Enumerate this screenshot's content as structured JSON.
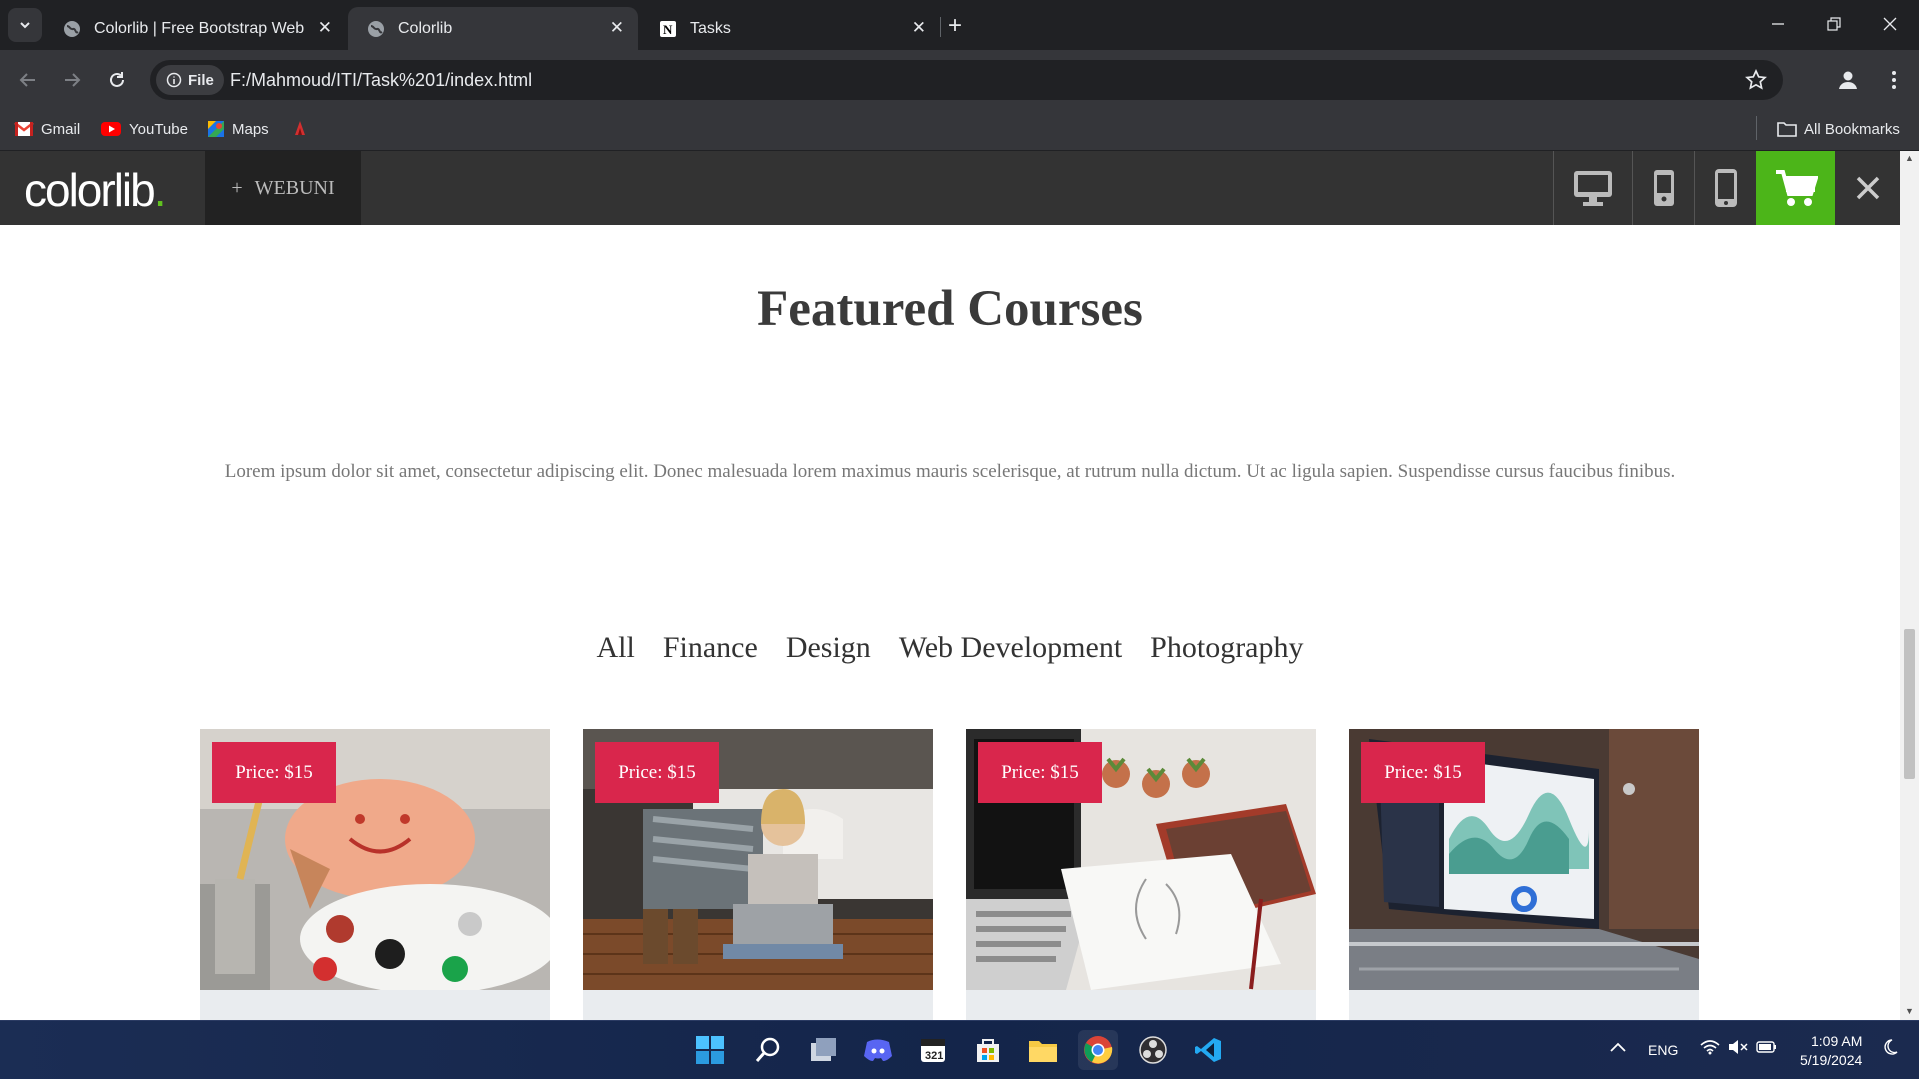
{
  "browser": {
    "tabs": [
      {
        "title": "Colorlib | Free Bootstrap Websit",
        "icon": "globe-icon",
        "active": false
      },
      {
        "title": "Colorlib",
        "icon": "globe-icon",
        "active": true
      },
      {
        "title": "Tasks",
        "icon": "notion-icon",
        "active": false
      }
    ],
    "address": {
      "chip": "File",
      "url": "F:/Mahmoud/ITI/Task%201/index.html"
    },
    "bookmarks": [
      {
        "label": "Gmail",
        "icon": "gmail-icon"
      },
      {
        "label": "YouTube",
        "icon": "youtube-icon"
      },
      {
        "label": "Maps",
        "icon": "maps-icon"
      }
    ],
    "all_bookmarks": "All Bookmarks"
  },
  "site": {
    "logo": "colorlib",
    "logo_dot": ".",
    "theme_label": "WEBUNI",
    "theme_plus": "+",
    "heading": "Featured Courses",
    "intro": "Lorem ipsum dolor sit amet, consectetur adipiscing elit. Donec malesuada lorem maximus mauris scelerisque, at rutrum nulla dictum. Ut ac ligula sapien. Suspendisse cursus faucibus finibus.",
    "filters": [
      "All",
      "Finance",
      "Design",
      "Web Development",
      "Photography"
    ],
    "cards": [
      {
        "price": "Price: $15",
        "image": "painting-palette-photo"
      },
      {
        "price": "Price: $15",
        "image": "woman-laptop-photo"
      },
      {
        "price": "Price: $15",
        "image": "laptop-sketchbook-photo"
      },
      {
        "price": "Price: $15",
        "image": "laptop-dashboard-photo"
      }
    ]
  },
  "colors": {
    "accent_green": "#4cb519",
    "price_badge": "#d9264c",
    "header_bg": "#333333"
  },
  "taskbar": {
    "apps": [
      "start-icon",
      "search-icon",
      "task-view-icon",
      "discord-icon",
      "calendar-app-icon",
      "store-icon",
      "file-explorer-icon",
      "chrome-icon",
      "obs-icon",
      "vscode-icon"
    ],
    "language": "ENG",
    "time": "1:09 AM",
    "date": "5/19/2024"
  }
}
